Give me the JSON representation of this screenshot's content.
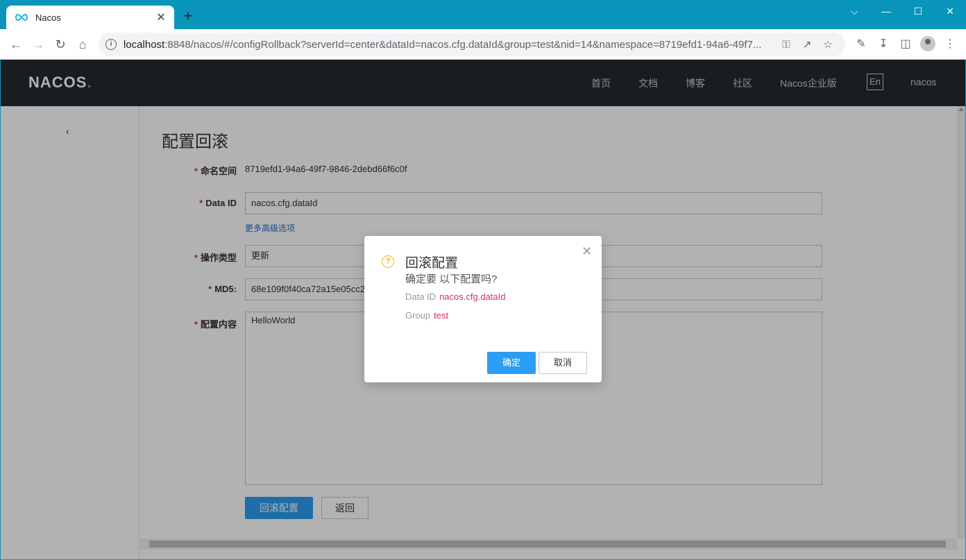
{
  "browser": {
    "tab_title": "Nacos",
    "tab_close": "✕",
    "new_tab": "+",
    "url_host": "localhost",
    "url_rest": ":8848/nacos/#/configRollback?serverId=center&dataId=nacos.cfg.dataId&group=test&nid=14&namespace=8719efd1-94a6-49f7...",
    "window_controls": [
      "⌵",
      "—",
      "☐",
      "✕"
    ]
  },
  "header": {
    "logo_text": "NACOS",
    "logo_dot": ".",
    "nav": [
      "首页",
      "文档",
      "博客",
      "社区",
      "Nacos企业版"
    ],
    "lang": "En",
    "user": "nacos"
  },
  "sidebar": {
    "collapse_icon": "‹"
  },
  "form": {
    "title": "配置回滚",
    "required_mark": "*",
    "namespace_label": "命名空间",
    "namespace_value": "8719efd1-94a6-49f7-9846-2debd66f6c0f",
    "dataid_label": "Data ID",
    "dataid_value": "nacos.cfg.dataId",
    "advanced_link": "更多高级选项",
    "optype_label": "操作类型",
    "optype_value": "更新",
    "md5_label": "MD5:",
    "md5_value": "68e109f0f40ca72a15e05cc22786f8e6",
    "content_label": "配置内容",
    "content_value": "HelloWorld",
    "rollback_button": "回滚配置",
    "back_button": "返回"
  },
  "dialog": {
    "title": "回滚配置",
    "message": "确定要 以下配置吗?",
    "dataid_label": "Data ID",
    "dataid_value": "nacos.cfg.dataId",
    "group_label": "Group",
    "group_value": "test",
    "ok_button": "确定",
    "cancel_button": "取消",
    "close_icon": "✕",
    "question_icon": "?"
  }
}
